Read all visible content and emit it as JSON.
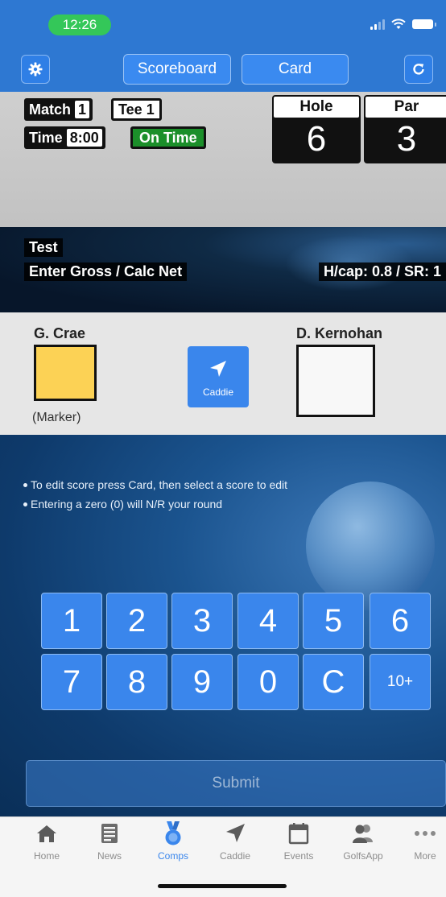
{
  "status_bar": {
    "time": "12:26"
  },
  "toolbar": {
    "settings_icon": "gear-icon",
    "scoreboard_label": "Scoreboard",
    "card_label": "Card",
    "refresh_icon": "refresh-icon"
  },
  "match_info": {
    "match_label": "Match",
    "match_value": "1",
    "tee_label": "Tee",
    "tee_value": "1",
    "time_label": "Time",
    "time_value": "8:00",
    "status": "On Time",
    "hole_label": "Hole",
    "hole_value": "6",
    "par_label": "Par",
    "par_value": "3"
  },
  "competition": {
    "name": "Test",
    "mode": "Enter Gross / Calc Net",
    "handicap": "H/cap: 0.8 / SR: 1"
  },
  "players": [
    {
      "name": "G. Crae",
      "note": "(Marker)",
      "box_color": "#fcd255"
    },
    {
      "name": "D. Kernohan",
      "note": "",
      "box_color": "#f8f8f8"
    }
  ],
  "caddie_button_label": "Caddie",
  "tips": [
    "To edit score press Card, then select a score to edit",
    "Entering a zero (0) will N/R your round"
  ],
  "keypad": [
    "1",
    "2",
    "3",
    "4",
    "5",
    "6",
    "7",
    "8",
    "9",
    "0",
    "C",
    "10+"
  ],
  "submit_label": "Submit",
  "tabs": [
    {
      "label": "Home",
      "icon": "home-icon",
      "active": false
    },
    {
      "label": "News",
      "icon": "news-icon",
      "active": false
    },
    {
      "label": "Comps",
      "icon": "medal-icon",
      "active": true
    },
    {
      "label": "Caddie",
      "icon": "caddie-arrow-icon",
      "active": false
    },
    {
      "label": "Events",
      "icon": "calendar-icon",
      "active": false
    },
    {
      "label": "GolfsApp",
      "icon": "people-icon",
      "active": false
    },
    {
      "label": "More",
      "icon": "more-icon",
      "active": false
    }
  ],
  "colors": {
    "accent": "#3a86ec",
    "on_time": "#1b8f2a",
    "tab_active": "#3a86ec",
    "tab_inactive": "#8d8d8d"
  }
}
